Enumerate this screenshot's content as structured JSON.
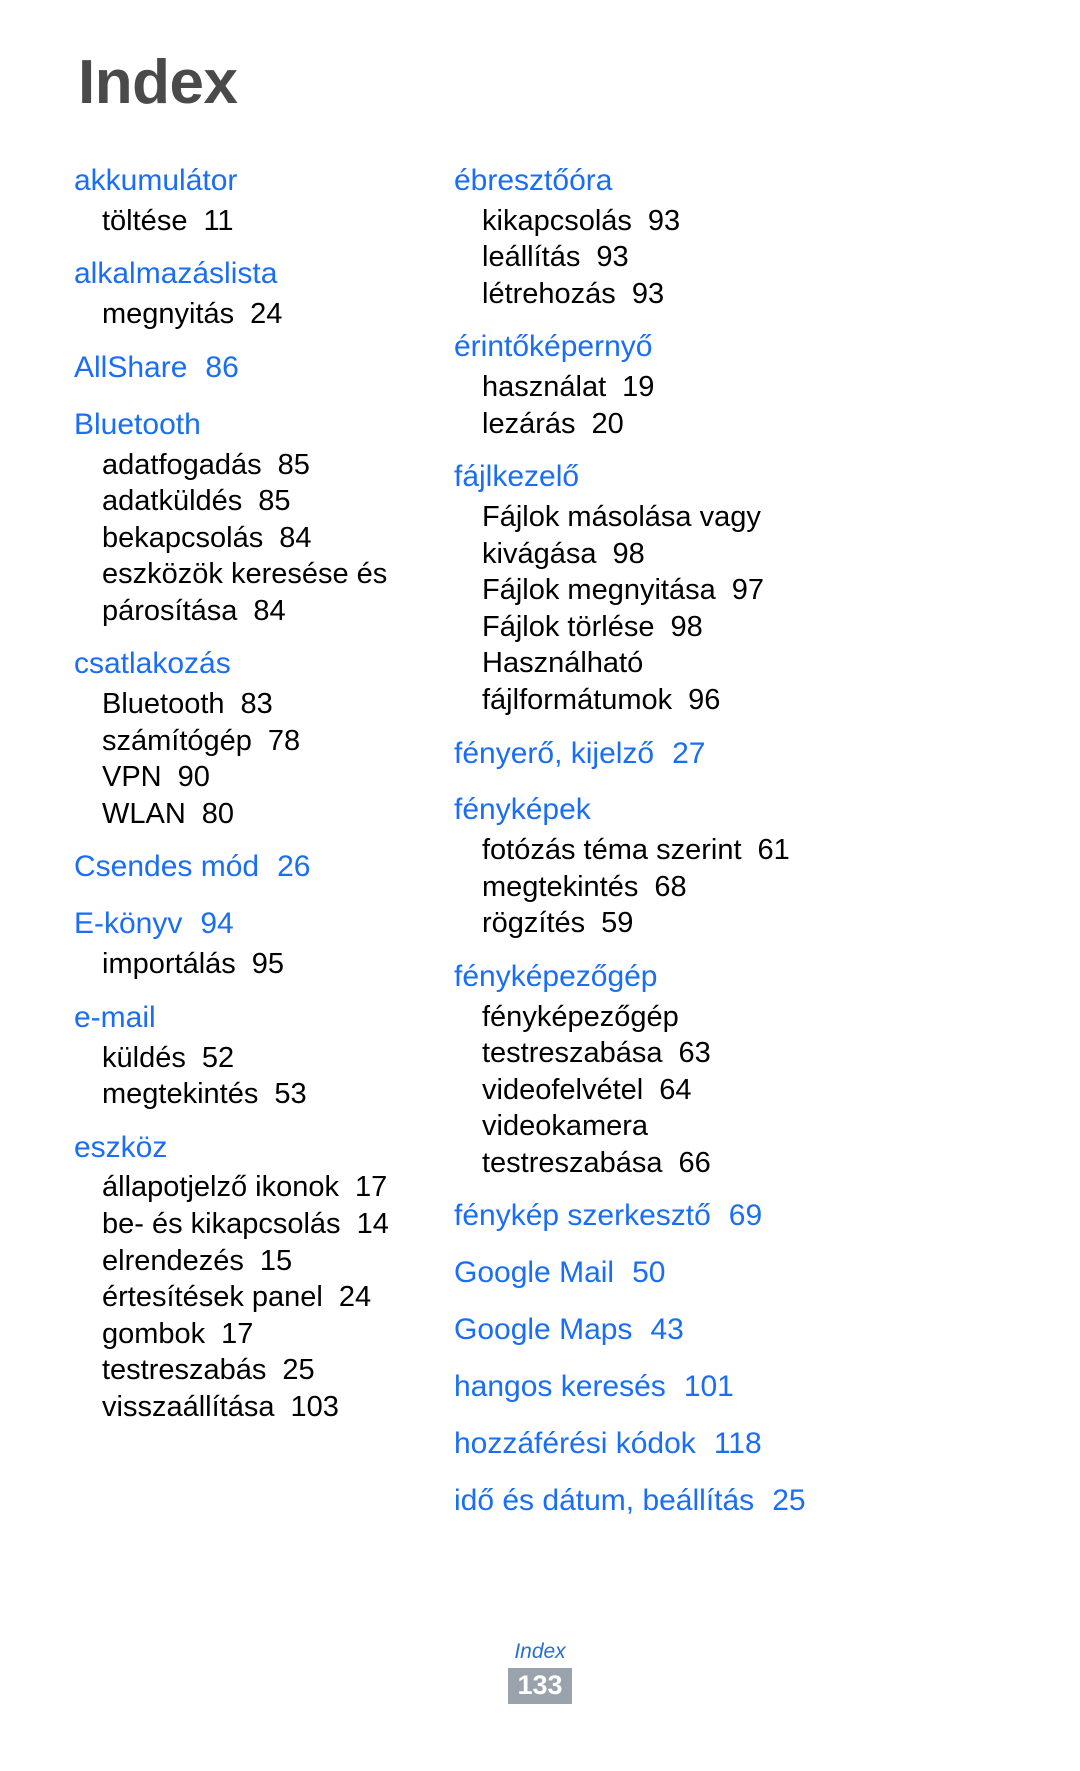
{
  "document": {
    "title": "Index",
    "footer": {
      "label": "Index",
      "page_number": "133"
    },
    "colors": {
      "heading": "#4a4a4a",
      "entry_link": "#1a6ef5",
      "sub_text": "#000000",
      "footer_label": "#2a6fd0",
      "page_box_bg": "#9aa2ab",
      "page_box_text": "#ffffff"
    }
  },
  "columns": {
    "left": [
      {
        "term": "akkumulátor",
        "page": "",
        "subentries": [
          {
            "text": "töltése",
            "page": "11"
          }
        ]
      },
      {
        "term": "alkalmazáslista",
        "page": "",
        "subentries": [
          {
            "text": "megnyitás",
            "page": "24"
          }
        ]
      },
      {
        "term": "AllShare",
        "page": "86",
        "subentries": []
      },
      {
        "term": "Bluetooth",
        "page": "",
        "subentries": [
          {
            "text": "adatfogadás",
            "page": "85"
          },
          {
            "text": "adatküldés",
            "page": "85"
          },
          {
            "text": "bekapcsolás",
            "page": "84"
          },
          {
            "text": "eszközök keresése és\npárosítása",
            "page": "84"
          }
        ]
      },
      {
        "term": "csatlakozás",
        "page": "",
        "subentries": [
          {
            "text": "Bluetooth",
            "page": "83"
          },
          {
            "text": "számítógép",
            "page": "78"
          },
          {
            "text": "VPN",
            "page": "90"
          },
          {
            "text": "WLAN",
            "page": "80"
          }
        ]
      },
      {
        "term": "Csendes mód",
        "page": "26",
        "subentries": []
      },
      {
        "term": "E-könyv",
        "page": "94",
        "subentries": [
          {
            "text": "importálás",
            "page": "95"
          }
        ]
      },
      {
        "term": "e-mail",
        "page": "",
        "subentries": [
          {
            "text": "küldés",
            "page": "52"
          },
          {
            "text": "megtekintés",
            "page": "53"
          }
        ]
      },
      {
        "term": "eszköz",
        "page": "",
        "subentries": [
          {
            "text": "állapotjelző ikonok",
            "page": "17"
          },
          {
            "text": "be- és kikapcsolás",
            "page": "14"
          },
          {
            "text": "elrendezés",
            "page": "15"
          },
          {
            "text": "értesítések panel",
            "page": "24"
          },
          {
            "text": "gombok",
            "page": "17"
          },
          {
            "text": "testreszabás",
            "page": "25"
          },
          {
            "text": "visszaállítása",
            "page": "103"
          }
        ]
      }
    ],
    "right": [
      {
        "term": "ébresztőóra",
        "page": "",
        "subentries": [
          {
            "text": "kikapcsolás",
            "page": "93"
          },
          {
            "text": "leállítás",
            "page": "93"
          },
          {
            "text": "létrehozás",
            "page": "93"
          }
        ]
      },
      {
        "term": "érintőképernyő",
        "page": "",
        "subentries": [
          {
            "text": "használat",
            "page": "19"
          },
          {
            "text": "lezárás",
            "page": "20"
          }
        ]
      },
      {
        "term": "fájlkezelő",
        "page": "",
        "subentries": [
          {
            "text": "Fájlok másolása vagy\nkivágása",
            "page": "98"
          },
          {
            "text": "Fájlok megnyitása",
            "page": "97"
          },
          {
            "text": "Fájlok törlése",
            "page": "98"
          },
          {
            "text": "Használható\nfájlformátumok",
            "page": "96"
          }
        ]
      },
      {
        "term": "fényerő, kijelző",
        "page": "27",
        "subentries": []
      },
      {
        "term": "fényképek",
        "page": "",
        "subentries": [
          {
            "text": "fotózás téma szerint",
            "page": "61"
          },
          {
            "text": "megtekintés",
            "page": "68"
          },
          {
            "text": "rögzítés",
            "page": "59"
          }
        ]
      },
      {
        "term": "fényképezőgép",
        "page": "",
        "subentries": [
          {
            "text": "fényképezőgép\ntestreszabása",
            "page": "63"
          },
          {
            "text": "videofelvétel",
            "page": "64"
          },
          {
            "text": "videokamera\ntestreszabása",
            "page": "66"
          }
        ]
      },
      {
        "term": "fénykép szerkesztő",
        "page": "69",
        "subentries": []
      },
      {
        "term": "Google Mail",
        "page": "50",
        "subentries": []
      },
      {
        "term": "Google Maps",
        "page": "43",
        "subentries": []
      },
      {
        "term": "hangos keresés",
        "page": "101",
        "subentries": []
      },
      {
        "term": "hozzáférési kódok",
        "page": "118",
        "subentries": []
      },
      {
        "term": "idő és dátum, beállítás",
        "page": "25",
        "subentries": []
      }
    ]
  }
}
